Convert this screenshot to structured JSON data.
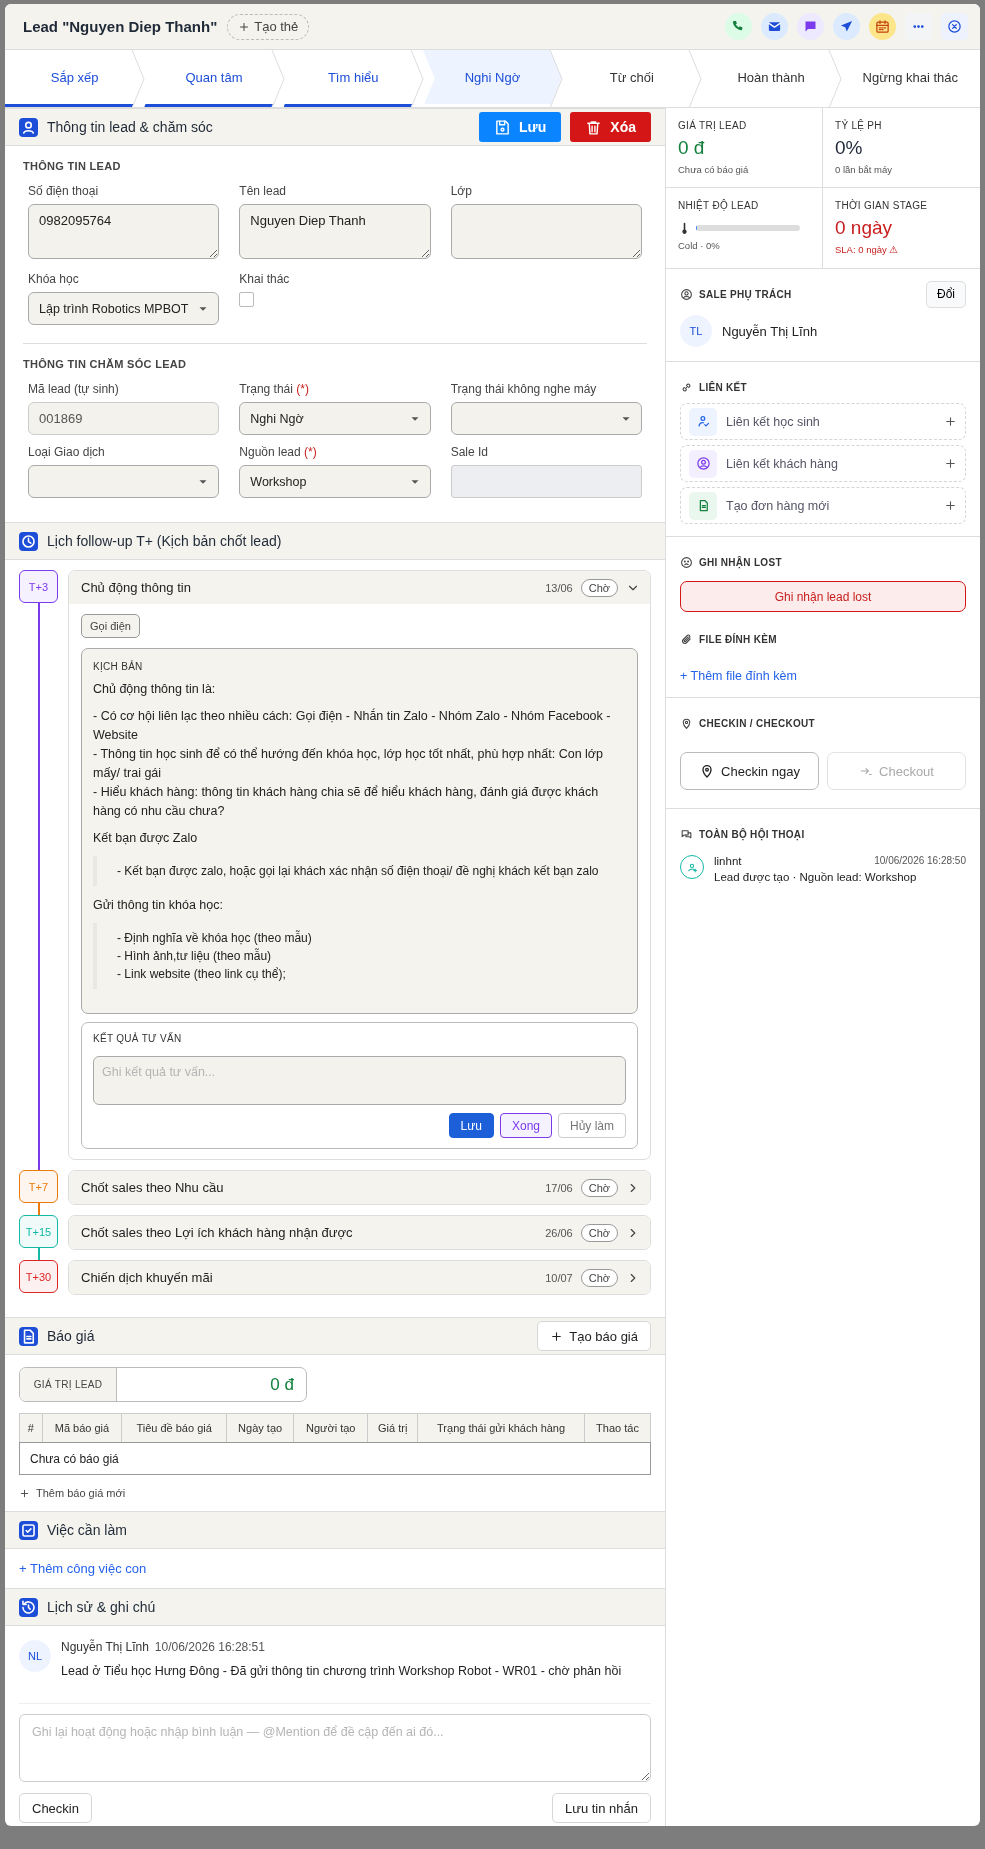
{
  "dialog": {
    "title": "Lead \"Nguyen Diep Thanh\"",
    "tag_button": "Tạo thẻ",
    "actions": [
      {
        "kind": "phone"
      },
      {
        "kind": "mail"
      },
      {
        "kind": "chat"
      },
      {
        "kind": "send"
      },
      {
        "kind": "calendar"
      },
      {
        "kind": "more"
      },
      {
        "kind": "close"
      }
    ]
  },
  "stages": [
    {
      "label": "Sắp xếp",
      "done": true,
      "selected": false
    },
    {
      "label": "Quan tâm",
      "done": true,
      "selected": false
    },
    {
      "label": "Tìm hiểu",
      "done": true,
      "selected": false
    },
    {
      "label": "Nghi Ngờ",
      "done": false,
      "selected": true
    },
    {
      "label": "Từ chối",
      "done": false,
      "selected": false
    },
    {
      "label": "Hoàn thành",
      "done": false,
      "selected": false
    },
    {
      "label": "Ngừng khai thác",
      "done": false,
      "selected": false
    }
  ],
  "lead_info": {
    "title": "Thông tin lead & chăm sóc",
    "save_button": "Lưu",
    "delete_button": "Xóa",
    "groups": [
      {
        "heading": "THÔNG TIN LEAD",
        "fields": [
          {
            "kind": "textarea",
            "label": "Số điện thoại",
            "value": "0982095764"
          },
          {
            "kind": "textarea",
            "label": "Tên lead",
            "value": "Nguyen Diep Thanh"
          },
          {
            "kind": "textarea",
            "label": "Lớp"
          },
          {
            "kind": "select",
            "label": "Khóa học",
            "value": "Lập trình Robotics MPBOT"
          },
          {
            "kind": "checkbox",
            "label": "Khai thác",
            "checked": false
          }
        ]
      },
      {
        "heading": "THÔNG TIN CHĂM SÓC LEAD",
        "fields": [
          {
            "kind": "readonly",
            "label": "Mã lead (tự sinh)",
            "value": "001869"
          },
          {
            "kind": "select",
            "label": "Trạng thái",
            "mark": "(*)",
            "value": "Nghi Ngờ"
          },
          {
            "kind": "select",
            "label": "Trạng thái không nghe máy"
          },
          {
            "kind": "select",
            "label": "Loại Giao dịch"
          },
          {
            "kind": "select",
            "label": "Nguồn lead",
            "mark": "(*)",
            "value": "Workshop"
          },
          {
            "kind": "disabled",
            "label": "Sale Id"
          }
        ]
      }
    ]
  },
  "followup": {
    "title": "Lịch follow-up T+ (Kịch bản chốt lead)",
    "steps": [
      {
        "badge": "T+3",
        "color": "#7c3aed",
        "title": "Chủ động thông tin",
        "date": "13/06",
        "status": "Chờ",
        "expanded": true,
        "channel": "Gọi điện",
        "script": {
          "label": "KỊCH BẢN",
          "blocks": [
            {
              "kind": "text",
              "lines": [
                "Chủ động thông tin là:"
              ]
            },
            {
              "kind": "text",
              "lines": [
                "- Có cơ hội liên lạc theo nhiều cách: Gọi điện - Nhắn tin Zalo - Nhóm Zalo - Nhóm Facebook - Website",
                "- Thông tin học sinh để có thể hướng đến khóa học, lớp học tốt nhất, phù hợp nhất: Con lớp mấy/ trai gái",
                "- Hiểu khách hàng: thông tin khách hàng chia sẽ để hiểu khách hàng, đánh giá được khách hàng có nhu cầu chưa?"
              ]
            },
            {
              "kind": "text",
              "lines": [
                "Kết bạn được Zalo"
              ]
            },
            {
              "kind": "quote",
              "lines": [
                "- Kết bạn được zalo, hoặc gọi lại khách xác nhận số điện thoại/ đề nghị khách kết bạn zalo"
              ]
            },
            {
              "kind": "text",
              "lines": [
                "Gửi thông tin khóa học:"
              ]
            },
            {
              "kind": "quote",
              "lines": [
                "- Định nghĩa về khóa học (theo mẫu)",
                "- Hình ảnh,tư liệu (theo mẫu)",
                "- Link website (theo link cụ thể);"
              ]
            }
          ]
        },
        "result": {
          "label": "KẾT QUẢ TƯ VẤN",
          "placeholder": "Ghi kết quả tư vấn...",
          "buttons": [
            {
              "kind": "primary",
              "label": "Lưu"
            },
            {
              "kind": "accent",
              "label": "Xong"
            },
            {
              "kind": "plain",
              "label": "Hủy làm"
            }
          ]
        }
      },
      {
        "badge": "T+7",
        "color": "#ea7a0c",
        "title": "Chốt sales theo Nhu cầu",
        "date": "17/06",
        "status": "Chờ",
        "expanded": false
      },
      {
        "badge": "T+15",
        "color": "#14b8a6",
        "title": "Chốt sales theo Lợi ích khách hàng nhận được",
        "date": "26/06",
        "status": "Chờ",
        "expanded": false
      },
      {
        "badge": "T+30",
        "color": "#dc2626",
        "title": "Chiến dịch khuyến mãi",
        "date": "10/07",
        "status": "Chờ",
        "expanded": false
      }
    ]
  },
  "quote": {
    "title": "Báo giá",
    "create_button": "Tạo báo giá",
    "value_label": "GIÁ TRỊ LEAD",
    "value": "0 đ",
    "table": {
      "columns": [
        "#",
        "Mã báo giá",
        "Tiêu đề báo giá",
        "Ngày tạo",
        "Người tạo",
        "Giá trị",
        "Trạng thái gửi khách hàng",
        "Thao tác"
      ],
      "empty": "Chưa có báo giá"
    },
    "add_link": "Thêm báo giá mới"
  },
  "tasks": {
    "title": "Việc cần làm",
    "add_link": "+ Thêm công việc con"
  },
  "history": {
    "title": "Lịch sử & ghi chú",
    "entries": [
      {
        "initials": "NL",
        "author": "Nguyễn Thị Lĩnh",
        "time": "10/06/2026 16:28:51",
        "text": "Lead ở Tiểu học Hưng Đông - Đã gửi thông tin chương trình Workshop Robot - WR01 - chờ phản hồi"
      }
    ],
    "placeholder": "Ghi lại hoạt động hoặc nhập bình luận — @Mention để đề cập đến ai đó...",
    "checkin_button": "Checkin",
    "send_button": "Lưu tin nhắn"
  },
  "sidebar": {
    "stats": [
      {
        "kind": "value",
        "label": "GIÁ TRỊ LEAD",
        "value": "0 đ",
        "color": "#15803d",
        "note": "Chưa có báo giá",
        "warning": false
      },
      {
        "kind": "value",
        "label": "TỶ LỆ PH",
        "value": "0%",
        "color": "#1f2937",
        "note": "0 lần bắt máy",
        "warning": false
      },
      {
        "kind": "meter",
        "label": "NHIỆT ĐỘ LEAD",
        "level": 0,
        "note": "Cold · 0%",
        "warning": false
      },
      {
        "kind": "value",
        "label": "THỜI GIAN STAGE",
        "value": "0 ngày",
        "color": "#c81e1e",
        "note": "SLA: 0 ngày ⚠",
        "warning": true
      }
    ],
    "sale": {
      "title": "SALE PHỤ TRÁCH",
      "change_button": "Đổi",
      "initials": "TL",
      "name": "Nguyễn Thị Lĩnh"
    },
    "links": {
      "title": "LIÊN KẾT",
      "items": [
        {
          "kind": "student",
          "label": "Liên kết học sinh"
        },
        {
          "kind": "customer",
          "label": "Liên kết khách hàng"
        },
        {
          "kind": "order",
          "label": "Tạo đơn hàng mới"
        }
      ]
    },
    "lost": {
      "title": "GHI NHẬN LOST",
      "button": "Ghi nhận lead lost"
    },
    "files": {
      "title": "FILE ĐÍNH KÈM",
      "add_link": "+ Thêm file đính kèm"
    },
    "checkin": {
      "title": "CHECKIN / CHECKOUT",
      "checkin_button": "Checkin ngay",
      "checkout_button": "Checkout",
      "checkout_disabled": true
    },
    "conversation": {
      "title": "TOÀN BỘ HỘI THOẠI",
      "entries": [
        {
          "user": "linhnt",
          "time": "10/06/2026 16:28:50",
          "text": "Lead được tạo · Nguồn lead: Workshop"
        }
      ]
    }
  }
}
